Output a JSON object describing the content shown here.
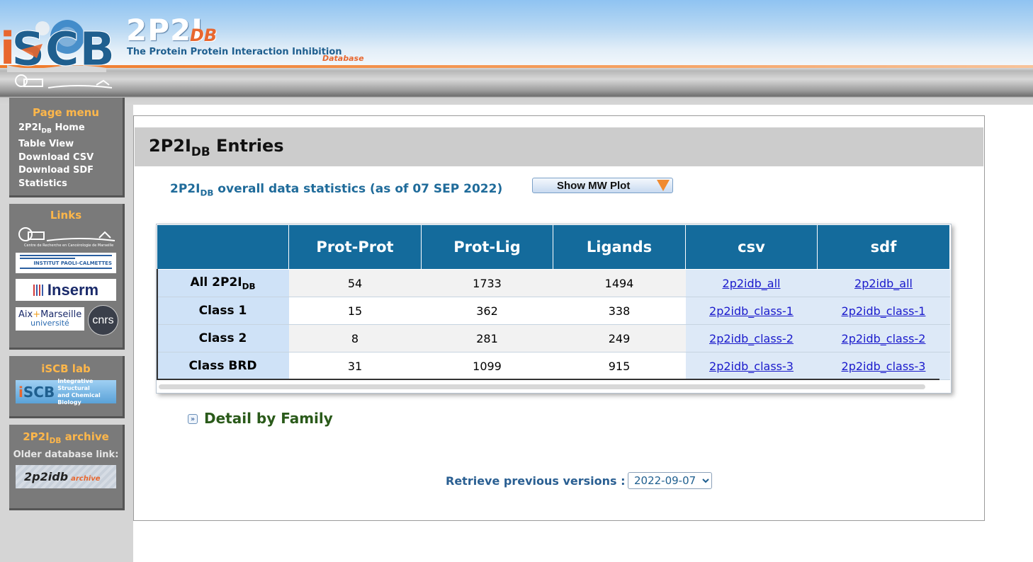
{
  "header": {
    "logo_iscb": "iSCB",
    "title": "2P2I",
    "title_db": "DB",
    "subtitle": "The Protein Protein Interaction Inhibition",
    "subtitle_database": "Database"
  },
  "sidebar": {
    "menu": {
      "heading": "Page menu",
      "items": [
        {
          "label": "2P2I",
          "sub": "DB",
          "suffix": " Home"
        },
        {
          "label": "Table View"
        },
        {
          "label": "Download CSV"
        },
        {
          "label": "Download SDF"
        },
        {
          "label": "Statistics"
        }
      ]
    },
    "links": {
      "heading": "Links",
      "logos": [
        "crcm-logo",
        "institut-paoli-calmettes-logo",
        "inserm-logo",
        "aix-marseille-universite-logo",
        "cnrs-logo"
      ],
      "ipc_text": "INSTITUT PAOLI-CALMETTES",
      "inserm_text": "Inserm",
      "amu_text_1": "Aix",
      "amu_text_2": "Marseille",
      "amu_text_3": "université",
      "cnrs_text": "cnrs",
      "crcm_caption": "Centre de Recherche en Cancérologie de Marseille"
    },
    "lab": {
      "heading": "iSCB lab",
      "logo_text_1": "Integrative Structural",
      "logo_text_2": "and Chemical Biology"
    },
    "archive": {
      "heading_main": "2P2I",
      "heading_sub": "DB",
      "heading_suffix": " archive",
      "older_label": "Older database link:",
      "logo_text": "2p2idb",
      "logo_text_archive": "archive"
    }
  },
  "main": {
    "title": "2P2I",
    "title_sub": "DB",
    "title_suffix": " Entries",
    "stats_caption_main": "2P2I",
    "stats_caption_sub": "DB",
    "stats_caption_suffix": " overall data statistics (as of 07 SEP 2022)",
    "mw_button": "Show MW Plot",
    "table": {
      "headers": [
        "",
        "Prot-Prot",
        "Prot-Lig",
        "Ligands",
        "csv",
        "sdf"
      ],
      "rows": [
        {
          "label": "All 2P2I",
          "label_sub": "DB",
          "prot_prot": "54",
          "prot_lig": "1733",
          "ligands": "1494",
          "csv": "2p2idb_all",
          "sdf": "2p2idb_all"
        },
        {
          "label": "Class 1",
          "label_sub": "",
          "prot_prot": "15",
          "prot_lig": "362",
          "ligands": "338",
          "csv": "2p2idb_class-1",
          "sdf": "2p2idb_class-1"
        },
        {
          "label": "Class 2",
          "label_sub": "",
          "prot_prot": "8",
          "prot_lig": "281",
          "ligands": "249",
          "csv": "2p2idb_class-2",
          "sdf": "2p2idb_class-2"
        },
        {
          "label": "Class BRD",
          "label_sub": "",
          "prot_prot": "31",
          "prot_lig": "1099",
          "ligands": "915",
          "csv": "2p2idb_class-3",
          "sdf": "2p2idb_class-3"
        }
      ]
    },
    "detail_icon": "expand-icon",
    "detail_title": "Detail by Family",
    "versions_label": "Retrieve previous versions :",
    "versions_selected": "2022-09-07"
  },
  "colors": {
    "table_header": "#146b9c",
    "sidebar_heading": "#ffb74a",
    "sidebar_box": "#7a7a7a",
    "link": "#1a1acc",
    "caption": "#1f6b9a",
    "detail_title": "#2a5a1a"
  }
}
